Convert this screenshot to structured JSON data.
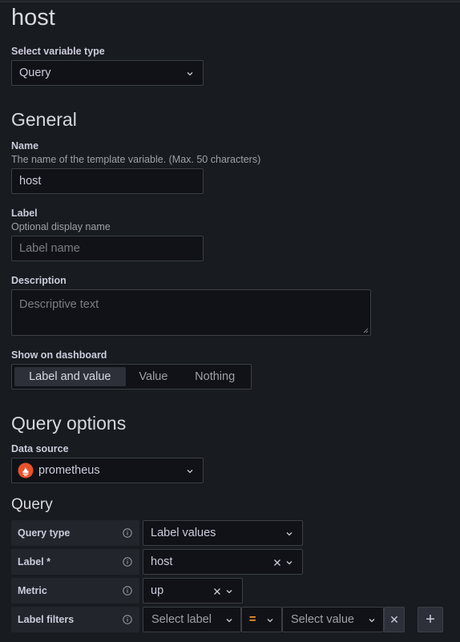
{
  "variable_name_heading": "host",
  "variable_type": {
    "label": "Select variable type",
    "value": "Query"
  },
  "general": {
    "heading": "General",
    "name": {
      "label": "Name",
      "help": "The name of the template variable. (Max. 50 characters)",
      "value": "host"
    },
    "label_field": {
      "label": "Label",
      "help": "Optional display name",
      "placeholder": "Label name"
    },
    "description": {
      "label": "Description",
      "placeholder": "Descriptive text"
    },
    "show_on_dashboard": {
      "label": "Show on dashboard",
      "options": [
        "Label and value",
        "Value",
        "Nothing"
      ],
      "selected": "Label and value"
    }
  },
  "query_options": {
    "heading": "Query options",
    "data_source": {
      "label": "Data source",
      "value": "prometheus",
      "icon": "prometheus-icon",
      "icon_color": "#e6522c"
    }
  },
  "query": {
    "heading": "Query",
    "rows": {
      "query_type": {
        "label": "Query type",
        "value": "Label values"
      },
      "label": {
        "label": "Label *",
        "value": "host"
      },
      "metric": {
        "label": "Metric",
        "value": "up"
      },
      "label_filters": {
        "label": "Label filters",
        "label_placeholder": "Select label",
        "operator": "=",
        "value_placeholder": "Select value",
        "remove_symbol": "✕",
        "add_symbol": "+"
      }
    }
  },
  "colors": {
    "background": "#181b1f",
    "input_bg": "#111217",
    "border": "#3b3f47",
    "operator": "#ff9830"
  }
}
